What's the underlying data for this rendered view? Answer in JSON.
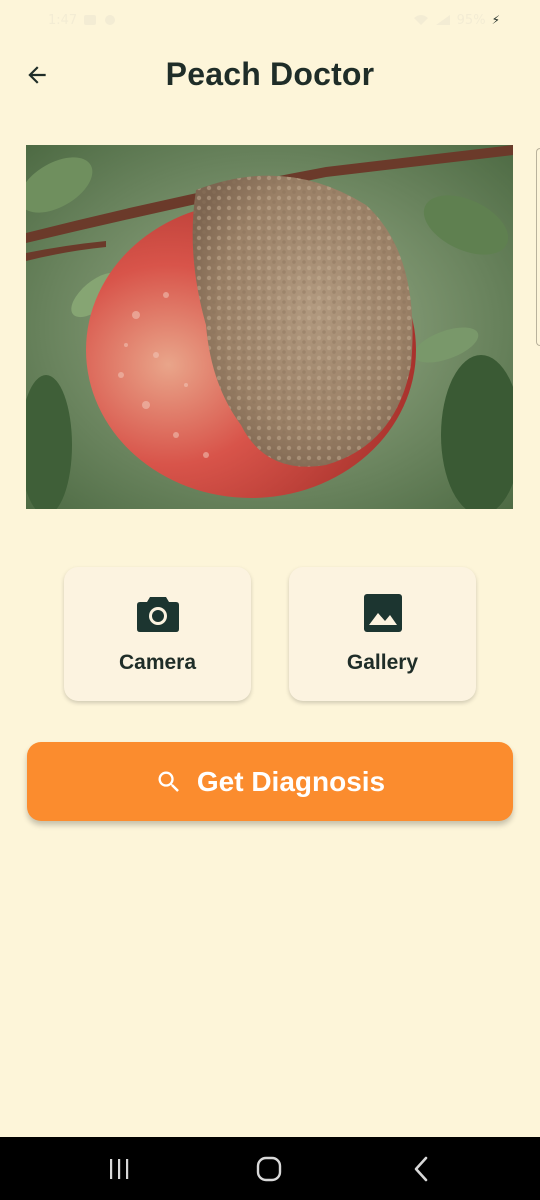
{
  "app": {
    "title": "Peach Doctor"
  },
  "status_bar": {
    "time": "1:47",
    "battery": "95%"
  },
  "image": {
    "subject": "peach fruit with brown rot"
  },
  "actions": {
    "camera_label": "Camera",
    "gallery_label": "Gallery",
    "diagnose_label": "Get Diagnosis"
  },
  "icons": {
    "back": "arrow-back-icon",
    "camera": "camera-icon",
    "gallery": "image-icon",
    "search": "search-icon",
    "recents": "recents-icon",
    "home": "home-icon",
    "nav_back": "chevron-left-icon"
  },
  "colors": {
    "background": "#fdf5d9",
    "card": "#fcf3e0",
    "accent": "#fb8c2e",
    "text": "#1f2d28",
    "nav_bar": "#000000"
  }
}
